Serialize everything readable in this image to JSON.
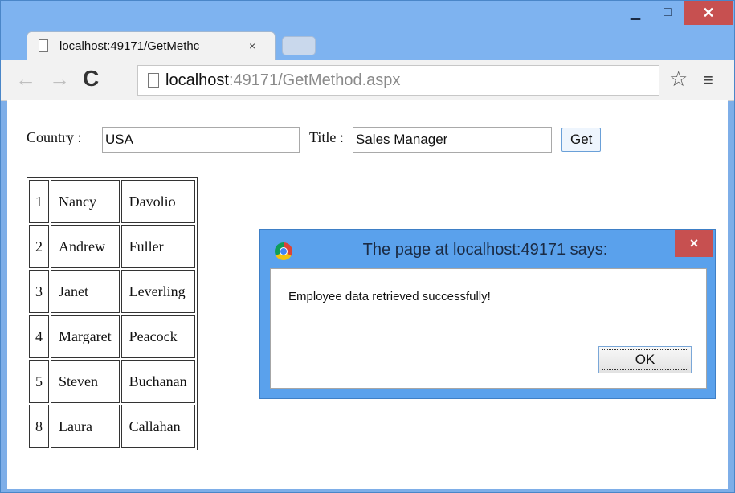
{
  "window": {
    "minimize_icon": "minimize-icon",
    "maximize_icon": "maximize-icon",
    "close_icon": "close-icon",
    "minimize_glyph": "▁",
    "maximize_glyph": "□",
    "close_glyph": "✕"
  },
  "tab": {
    "title": "localhost:49171/GetMethc",
    "close_glyph": "×"
  },
  "toolbar": {
    "back_glyph": "←",
    "forward_glyph": "→",
    "reload_glyph": "C",
    "url_host": "localhost",
    "url_rest": ":49171/GetMethod.aspx",
    "star_glyph": "☆",
    "menu_glyph": "≡"
  },
  "form": {
    "country_label": "Country :",
    "country_value": "USA",
    "title_label": "Title :",
    "title_value": "Sales Manager",
    "get_button": "Get"
  },
  "employees": [
    {
      "id": "1",
      "first": "Nancy",
      "last": "Davolio"
    },
    {
      "id": "2",
      "first": "Andrew",
      "last": "Fuller"
    },
    {
      "id": "3",
      "first": "Janet",
      "last": "Leverling"
    },
    {
      "id": "4",
      "first": "Margaret",
      "last": "Peacock"
    },
    {
      "id": "5",
      "first": "Steven",
      "last": "Buchanan"
    },
    {
      "id": "8",
      "first": "Laura",
      "last": "Callahan"
    }
  ],
  "dialog": {
    "title": "The page at localhost:49171 says:",
    "message": "Employee data retrieved successfully!",
    "ok_button": "OK",
    "close_glyph": "×"
  },
  "colors": {
    "frame": "#7eb3f0",
    "close_red": "#c75050",
    "dialog_frame": "#5aa1ec"
  }
}
